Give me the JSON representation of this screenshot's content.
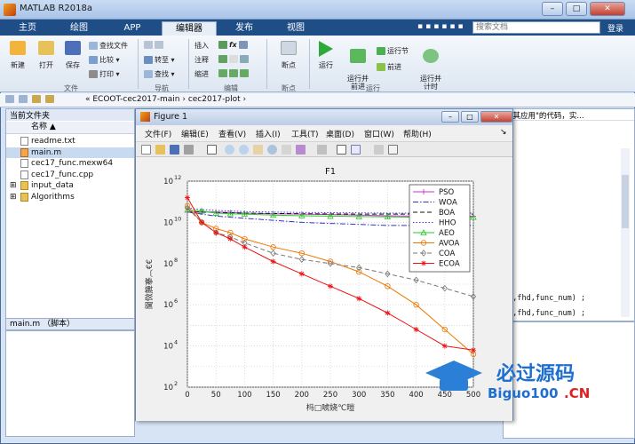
{
  "window": {
    "title": "MATLAB R2018a"
  },
  "window_buttons": {
    "minimize": "–",
    "maximize": "□",
    "close": "✕"
  },
  "tabs": [
    "主页",
    "绘图",
    "APP",
    "编辑器",
    "发布",
    "视图"
  ],
  "search": {
    "placeholder": "搜索文档"
  },
  "login": "登录",
  "ribbon": {
    "file": {
      "new": "新建",
      "open": "打开",
      "save": "保存",
      "find_files": "查找文件",
      "compare": "比较",
      "print": "打印",
      "group": "文件"
    },
    "nav": {
      "goto": "转至",
      "find": "查找",
      "group": "导航"
    },
    "edit": {
      "insert": "插入",
      "comment": "注释",
      "indent": "缩进",
      "fx": "fx",
      "group": "编辑"
    },
    "breakpoints": {
      "label": "断点",
      "group": "断点"
    },
    "run": {
      "run": "运行",
      "run_advance": "运行并\n前进",
      "run_section": "运行节",
      "advance": "前进",
      "run_time": "运行并\n计时",
      "group": "运行"
    }
  },
  "address": {
    "crumbs": "« ECOOT-cec2017-main  ›  cec2017-plot  ›"
  },
  "left_panel": {
    "title": "当前文件夹",
    "column": "名称 ▲",
    "files": [
      {
        "name": "readme.txt",
        "kind": "file",
        "selected": false
      },
      {
        "name": "main.m",
        "kind": "mfile",
        "selected": true
      },
      {
        "name": "cec17_func.mexw64",
        "kind": "file",
        "selected": false
      },
      {
        "name": "cec17_func.cpp",
        "kind": "file",
        "selected": false
      },
      {
        "name": "input_data",
        "kind": "folder",
        "selected": false
      },
      {
        "name": "Algorithms",
        "kind": "folder",
        "selected": false
      }
    ],
    "detail_title": "main.m （脚本）"
  },
  "right_panel": {
    "top_text": "及其应用\"的代码，实...",
    "code_lines": [
      "on,fhd,func_num) ;",
      "on,fhd,func_num) ;"
    ]
  },
  "figure": {
    "title": "Figure 1",
    "menu": [
      "文件(F)",
      "编辑(E)",
      "查看(V)",
      "插入(I)",
      "工具(T)",
      "桌面(D)",
      "窗口(W)",
      "帮助(H)"
    ]
  },
  "watermark": {
    "line1": "必过源码",
    "line2": "Biguo100",
    "line3": ".CN"
  },
  "chart_data": {
    "type": "line",
    "title": "F1",
    "xlabel": "杩□唬娆℃暟",
    "ylabel": "閫傚簲搴︹€€",
    "xlim": [
      0,
      500
    ],
    "ylim_log10": [
      2,
      12
    ],
    "yscale": "log",
    "x_ticks": [
      0,
      50,
      100,
      150,
      200,
      250,
      300,
      350,
      400,
      450,
      500
    ],
    "y_tick_exponents": [
      2,
      4,
      6,
      8,
      10,
      12
    ],
    "grid": true,
    "legend_position": "top-right",
    "x": [
      0,
      25,
      50,
      75,
      100,
      150,
      200,
      250,
      300,
      350,
      400,
      450,
      500
    ],
    "series": [
      {
        "name": "PSO",
        "color": "#cc33cc",
        "marker": "+",
        "dash": "solid",
        "log10_values": [
          10.5,
          10.5,
          10.5,
          10.48,
          10.45,
          10.42,
          10.4,
          10.38,
          10.35,
          10.32,
          10.3,
          10.3,
          10.3
        ]
      },
      {
        "name": "WOA",
        "color": "#3333cc",
        "marker": "",
        "dash": "dashdot",
        "log10_values": [
          10.5,
          10.4,
          10.3,
          10.25,
          10.2,
          10.1,
          10.0,
          9.95,
          9.9,
          9.85,
          9.85,
          9.85,
          9.85
        ]
      },
      {
        "name": "BOA",
        "color": "#111111",
        "marker": "",
        "dash": "dashed",
        "log10_values": [
          10.5,
          10.5,
          10.48,
          10.46,
          10.45,
          10.43,
          10.42,
          10.41,
          10.4,
          10.4,
          10.4,
          10.4,
          10.4
        ]
      },
      {
        "name": "HHO",
        "color": "#3333ff",
        "marker": "",
        "dash": "dotted",
        "log10_values": [
          10.7,
          10.62,
          10.58,
          10.55,
          10.52,
          10.5,
          10.48,
          10.47,
          10.46,
          10.45,
          10.45,
          10.45,
          10.45
        ]
      },
      {
        "name": "AEO",
        "color": "#22cc22",
        "marker": "^",
        "dash": "solid",
        "log10_values": [
          10.6,
          10.55,
          10.45,
          10.42,
          10.4,
          10.35,
          10.32,
          10.3,
          10.28,
          10.27,
          10.25,
          10.25,
          10.25
        ]
      },
      {
        "name": "AVOA",
        "color": "#ee7700",
        "marker": "o",
        "dash": "solid",
        "log10_values": [
          10.8,
          10.0,
          9.7,
          9.5,
          9.2,
          8.8,
          8.5,
          8.1,
          7.6,
          6.9,
          6.0,
          4.8,
          3.6
        ]
      },
      {
        "name": "COA",
        "color": "#777777",
        "marker": "d",
        "dash": "dashed",
        "log10_values": [
          10.7,
          10.0,
          9.5,
          9.3,
          9.0,
          8.5,
          8.2,
          8.0,
          7.8,
          7.5,
          7.2,
          6.8,
          6.4
        ]
      },
      {
        "name": "ECOA",
        "color": "#ee1111",
        "marker": "*",
        "dash": "solid",
        "log10_values": [
          11.2,
          10.0,
          9.5,
          9.2,
          8.8,
          8.1,
          7.5,
          6.9,
          6.3,
          5.6,
          4.8,
          4.0,
          3.8
        ]
      }
    ]
  }
}
